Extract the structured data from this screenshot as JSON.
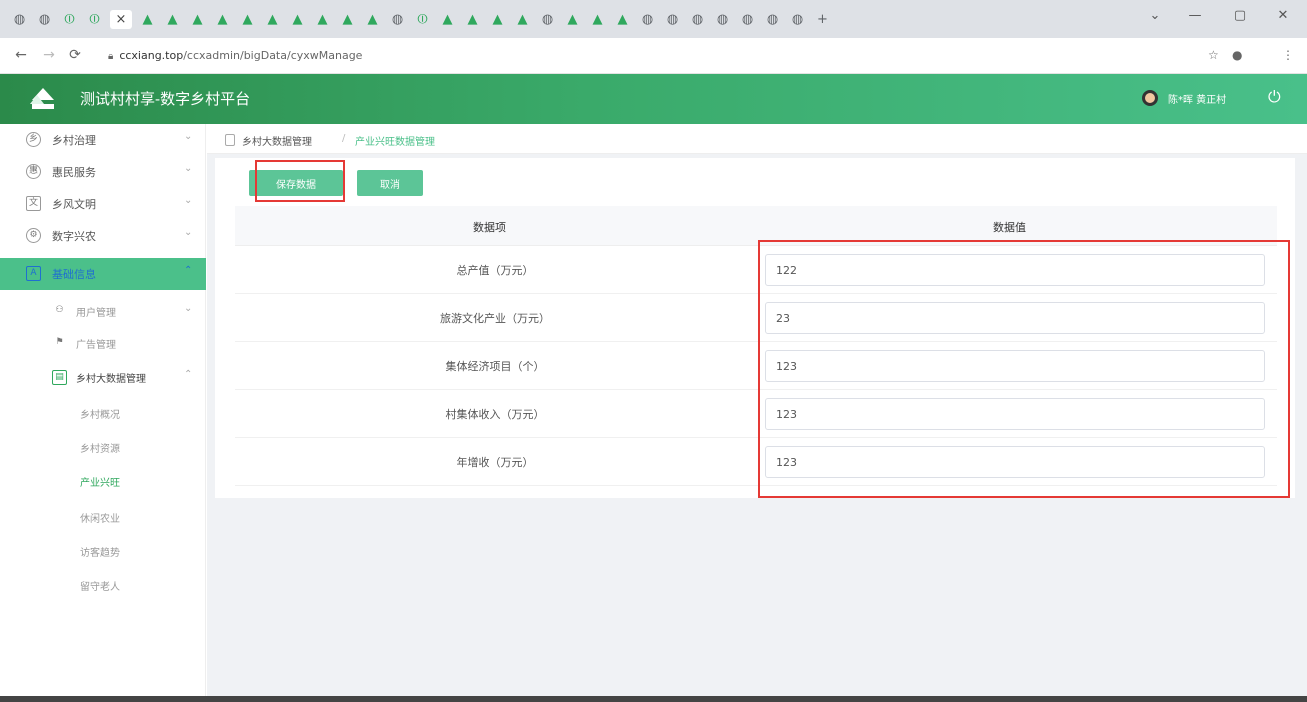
{
  "browser": {
    "url_host": "ccxiang.top",
    "url_path": "/ccxadmin/bigData/cyxwManage",
    "tabs_icons": [
      "globe",
      "globe",
      "power",
      "power",
      "close",
      "logo",
      "logo",
      "logo",
      "logo",
      "logo",
      "logo",
      "logo",
      "logo",
      "logo",
      "logo",
      "globe",
      "power",
      "logo",
      "logo",
      "logo",
      "logo",
      "globe",
      "logo",
      "logo",
      "logo",
      "globe",
      "globe",
      "globe",
      "globe",
      "globe",
      "globe",
      "globe"
    ],
    "new_tab": "+",
    "win_menu": "⌄",
    "win_min": "—",
    "win_max": "▢",
    "win_close": "✕"
  },
  "app": {
    "title": "测试村村享-数字乡村平台",
    "user": "陈*晖 黄正村"
  },
  "sidebar": {
    "items": [
      {
        "label": "乡村治理"
      },
      {
        "label": "惠民服务"
      },
      {
        "label": "乡风文明"
      },
      {
        "label": "数字兴农"
      },
      {
        "label": "基础信息"
      }
    ],
    "sub": [
      {
        "label": "用户管理"
      },
      {
        "label": "广告管理"
      },
      {
        "label": "乡村大数据管理"
      }
    ],
    "leaves": [
      "乡村概况",
      "乡村资源",
      "产业兴旺",
      "休闲农业",
      "访客趋势",
      "留守老人"
    ]
  },
  "breadcrumb": {
    "parent": "乡村大数据管理",
    "sep": "/",
    "current": "产业兴旺数据管理"
  },
  "toolbar": {
    "save": "保存数据",
    "cancel": "取消"
  },
  "table": {
    "headers": [
      "数据项",
      "数据值"
    ],
    "rows": [
      {
        "label": "总产值（万元）",
        "value": "122"
      },
      {
        "label": "旅游文化产业（万元）",
        "value": "23"
      },
      {
        "label": "集体经济项目（个）",
        "value": "123"
      },
      {
        "label": "村集体收入（万元）",
        "value": "123"
      },
      {
        "label": "年增收（万元）",
        "value": "123"
      }
    ]
  }
}
